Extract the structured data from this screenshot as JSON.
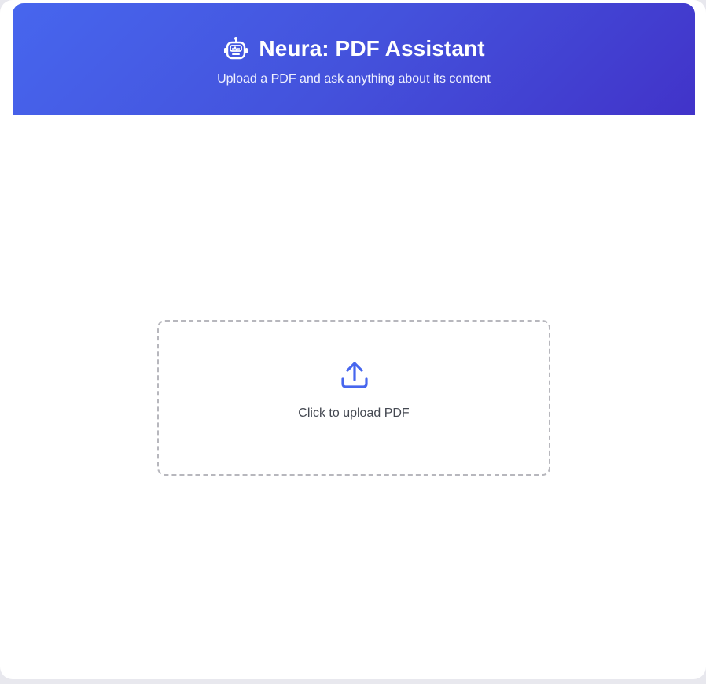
{
  "header": {
    "icon": "robot-icon",
    "title": "Neura: PDF Assistant",
    "subtitle": "Upload a PDF and ask anything about its content",
    "gradient_start": "#4766ee",
    "gradient_end": "#4133c9"
  },
  "upload": {
    "icon": "upload-icon",
    "label": "Click to upload PDF",
    "accent_color": "#4766ee",
    "border_color": "#b7b7bd"
  }
}
